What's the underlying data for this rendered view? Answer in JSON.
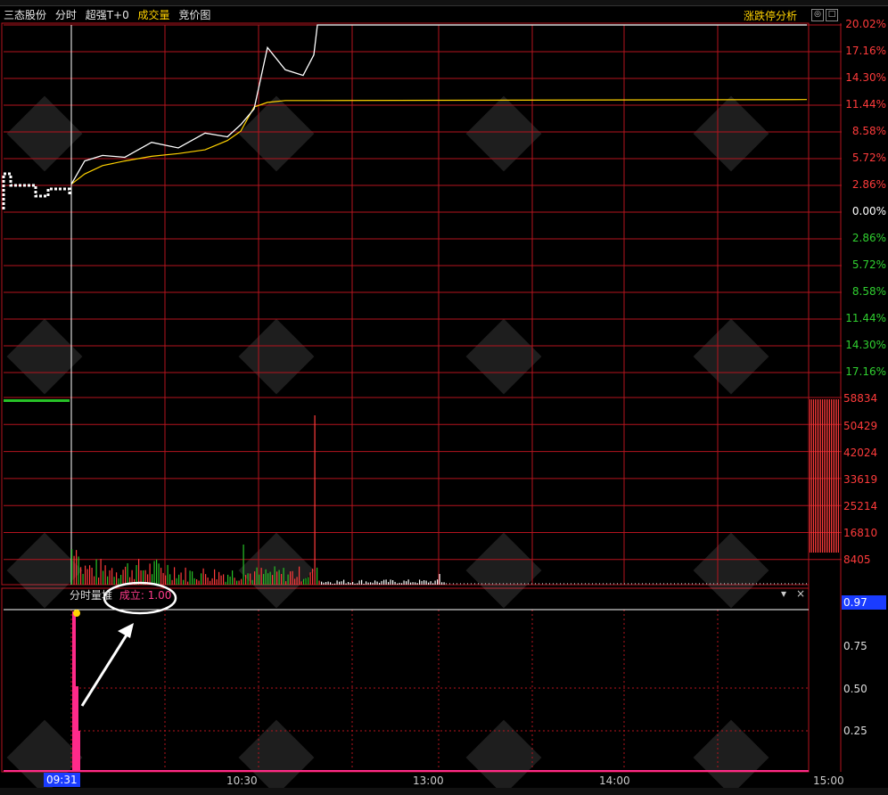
{
  "header": {
    "stock_name": "三态股份",
    "tab_minute": "分时",
    "tab_super": "超强T+0",
    "tab_volume": "成交量",
    "tab_auction": "竞价图",
    "right_title": "涨跌停分析",
    "close_label": "×",
    "settings_label": "◎",
    "max_label": "□"
  },
  "price_axis": {
    "up_labels": [
      "20.02%",
      "17.16%",
      "14.30%",
      "11.44%",
      "8.58%",
      "5.72%",
      "2.86%"
    ],
    "zero_label": "0.00%",
    "down_labels": [
      "2.86%",
      "5.72%",
      "8.58%",
      "11.44%",
      "14.30%",
      "17.16%"
    ]
  },
  "volume_axis": {
    "labels": [
      "58834",
      "50429",
      "42024",
      "33619",
      "25214",
      "16810",
      "8405"
    ]
  },
  "indicator": {
    "name": "分时量堆",
    "param_label": "成立: 1.00",
    "axis_current": "0.97",
    "axis_labels": [
      "0.75",
      "0.50",
      "0.25"
    ],
    "dropdown_label": "▾",
    "close_label": "×"
  },
  "time_axis": {
    "current": "09:31",
    "labels": [
      "10:30",
      "13:00",
      "14:00",
      "15:00"
    ]
  },
  "chart_data": {
    "type": "line",
    "series": [
      {
        "values": [
          2.9,
          5.4,
          6.0,
          5.8,
          7.4,
          6.8,
          8.4,
          8.0,
          9.3,
          11.0,
          17.6,
          15.2,
          14.6,
          16.8,
          20.02,
          20.02
        ]
      },
      {
        "values": [
          2.9,
          4.0,
          4.9,
          5.4,
          5.9,
          6.2,
          6.6,
          7.6,
          8.6,
          11.2,
          11.7,
          11.9,
          11.9,
          11.9,
          11.9,
          12.0
        ]
      }
    ],
    "ylim": [
      -20.02,
      20.02
    ],
    "colors": {
      "price": "#ffffff",
      "avg": "#ffd200",
      "grid": "#b4141e",
      "indicator": "#ff2a8a"
    }
  }
}
